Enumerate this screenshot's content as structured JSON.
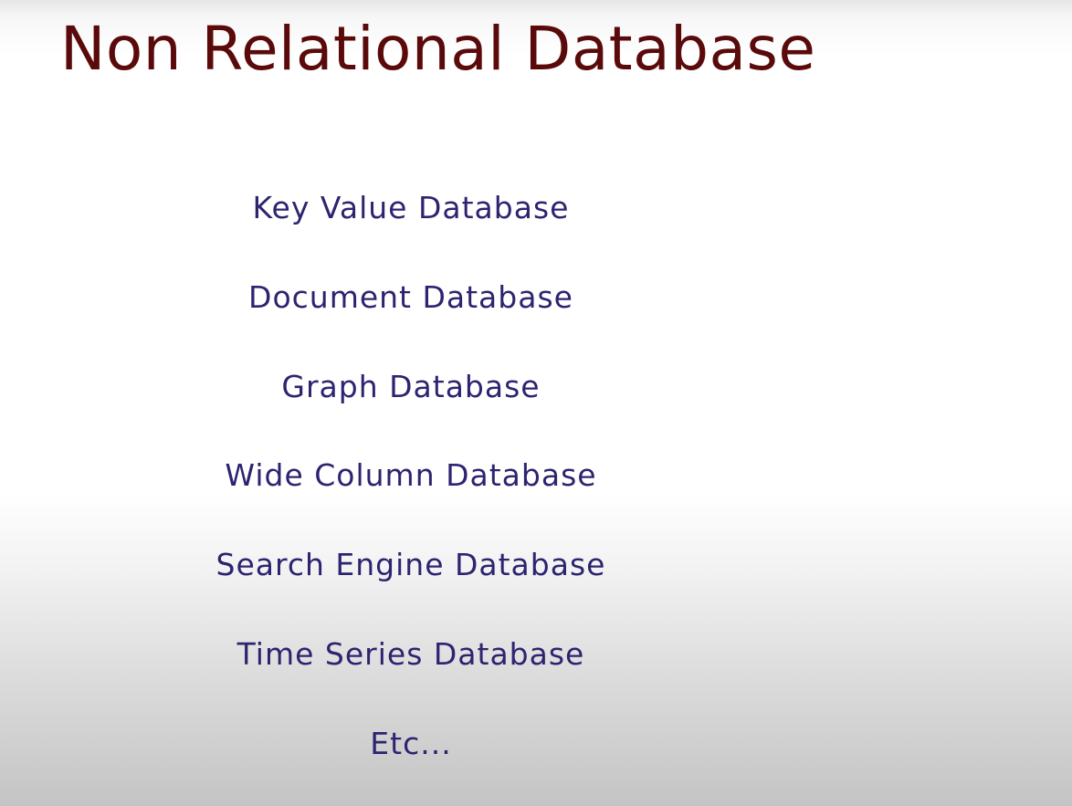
{
  "slide": {
    "title": "Non Relational Database",
    "items": [
      "Key Value Database",
      "Document Database",
      "Graph Database",
      "Wide Column Database",
      "Search Engine Database",
      "Time Series Database",
      "Etc..."
    ]
  }
}
